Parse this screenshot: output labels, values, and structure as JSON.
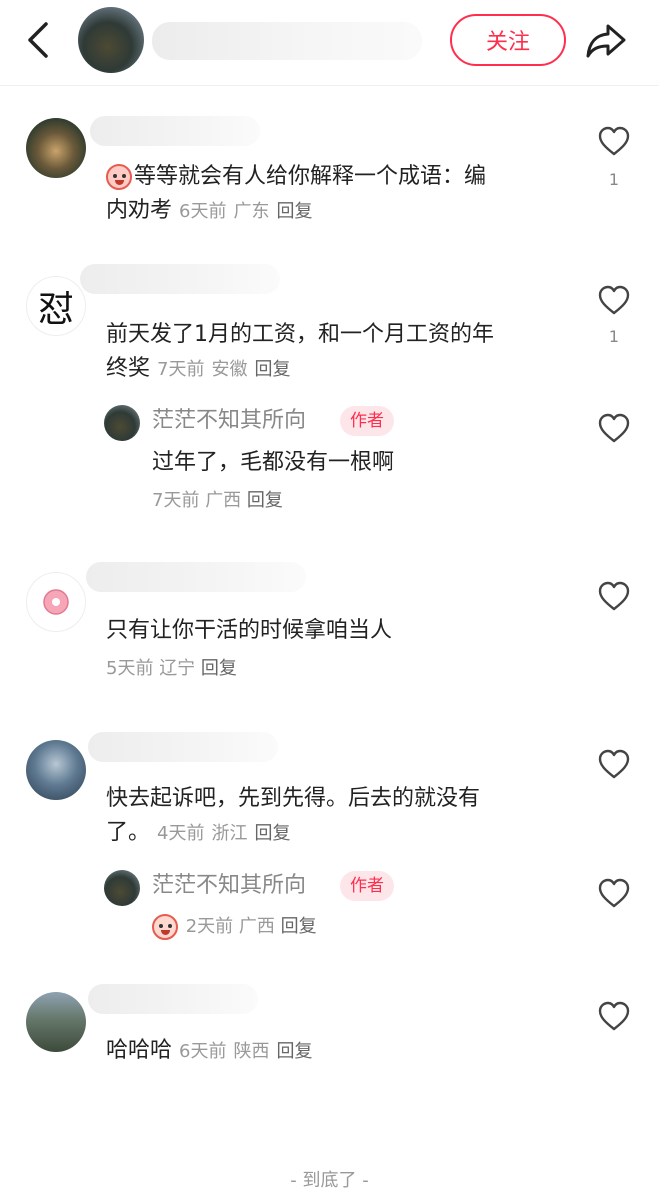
{
  "header": {
    "follow_label": "关注"
  },
  "comments": [
    {
      "text": "等等就会有人给你解释一个成语：编内劝考",
      "line1": "等等就会有人给你解释一个成语：编",
      "line2": "内劝考",
      "time": "6天前",
      "location": "广东",
      "reply": "回复",
      "likes": "1"
    },
    {
      "avatar_char": "怼",
      "line1": "前天发了1月的工资，和一个月工资的年",
      "line2": "终奖",
      "time": "7天前",
      "location": "安徽",
      "reply": "回复",
      "likes": "1",
      "sub": {
        "name": "茫茫不知其所向",
        "tag": "作者",
        "text": "过年了，毛都没有一根啊",
        "time": "7天前",
        "location": "广西",
        "reply": "回复"
      }
    },
    {
      "text": "只有让你干活的时候拿咱当人",
      "time": "5天前",
      "location": "辽宁",
      "reply": "回复"
    },
    {
      "line1": "快去起诉吧，先到先得。后去的就没有",
      "line2": "了。",
      "time": "4天前",
      "location": "浙江",
      "reply": "回复",
      "sub": {
        "name": "茫茫不知其所向",
        "tag": "作者",
        "time": "2天前",
        "location": "广西",
        "reply": "回复"
      }
    },
    {
      "text": "哈哈哈",
      "time": "6天前",
      "location": "陕西",
      "reply": "回复"
    }
  ],
  "footer": {
    "end_label": "- 到底了 -"
  },
  "icons": {
    "back": "chevron-left-icon",
    "share": "share-arrow-icon",
    "like": "heart-outline-icon"
  },
  "colors": {
    "accent": "#ff2e4d",
    "muted": "#999999"
  }
}
